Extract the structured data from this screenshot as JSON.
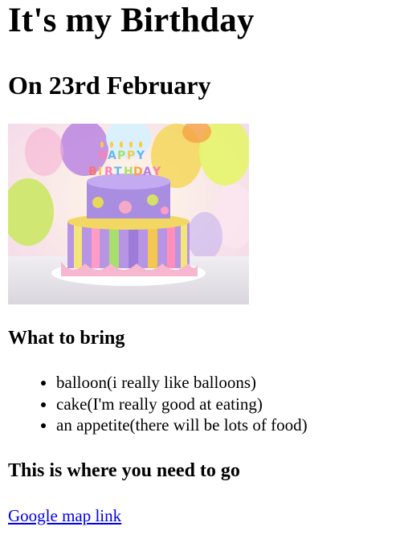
{
  "page": {
    "title": "It's my Birthday",
    "subtitle": "On 23rd February",
    "image_alt": "Birthday cake with Happy Birthday candles and balloons",
    "image_candles": [
      "H",
      "A",
      "P",
      "P",
      "Y",
      "B",
      "I",
      "R",
      "T",
      "H",
      "D",
      "A",
      "Y"
    ],
    "what_to_bring": {
      "heading": "What to bring",
      "items": [
        "balloon(i really like balloons)",
        "cake(I'm really good at eating)",
        "an appetite(there will be lots of food)"
      ]
    },
    "where": {
      "heading": "This is where you need to go",
      "link_text": "Google map link"
    },
    "colors": {
      "link": "#0000ee",
      "text": "#000000",
      "background": "#ffffff"
    }
  }
}
